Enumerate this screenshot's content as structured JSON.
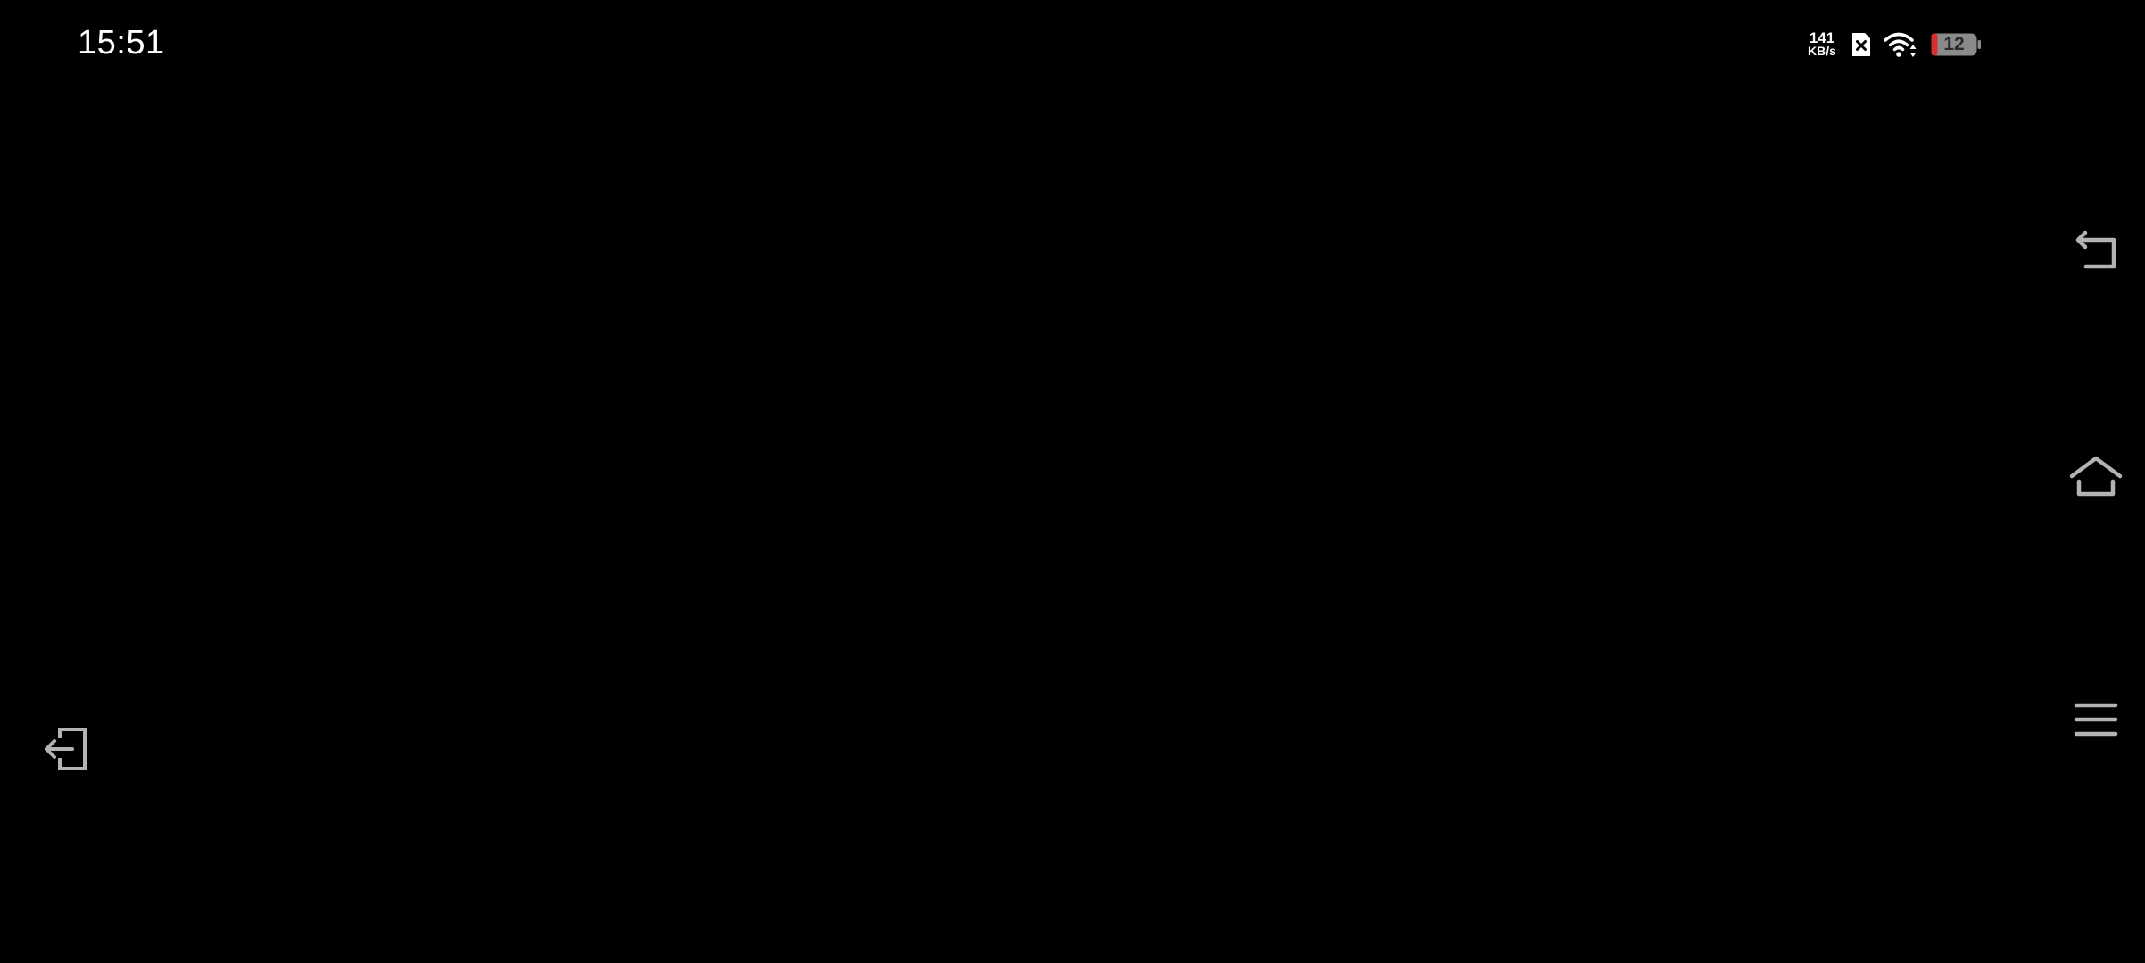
{
  "status_bar": {
    "time": "15:51",
    "net_speed_value": "141",
    "net_speed_unit": "KB/s",
    "battery_level": "12",
    "battery_color": "#c0392b",
    "icons": [
      "no-sim-icon",
      "wifi-icon",
      "battery-icon"
    ]
  },
  "navigation": {
    "buttons": [
      {
        "name": "back",
        "icon": "back-arrow-icon"
      },
      {
        "name": "home",
        "icon": "home-icon"
      },
      {
        "name": "menu",
        "icon": "hamburger-menu-icon"
      }
    ]
  },
  "exit": {
    "icon": "exit-icon"
  },
  "colors": {
    "background": "#000000",
    "icon_gray": "#b3b3b3",
    "text": "#ffffff"
  }
}
